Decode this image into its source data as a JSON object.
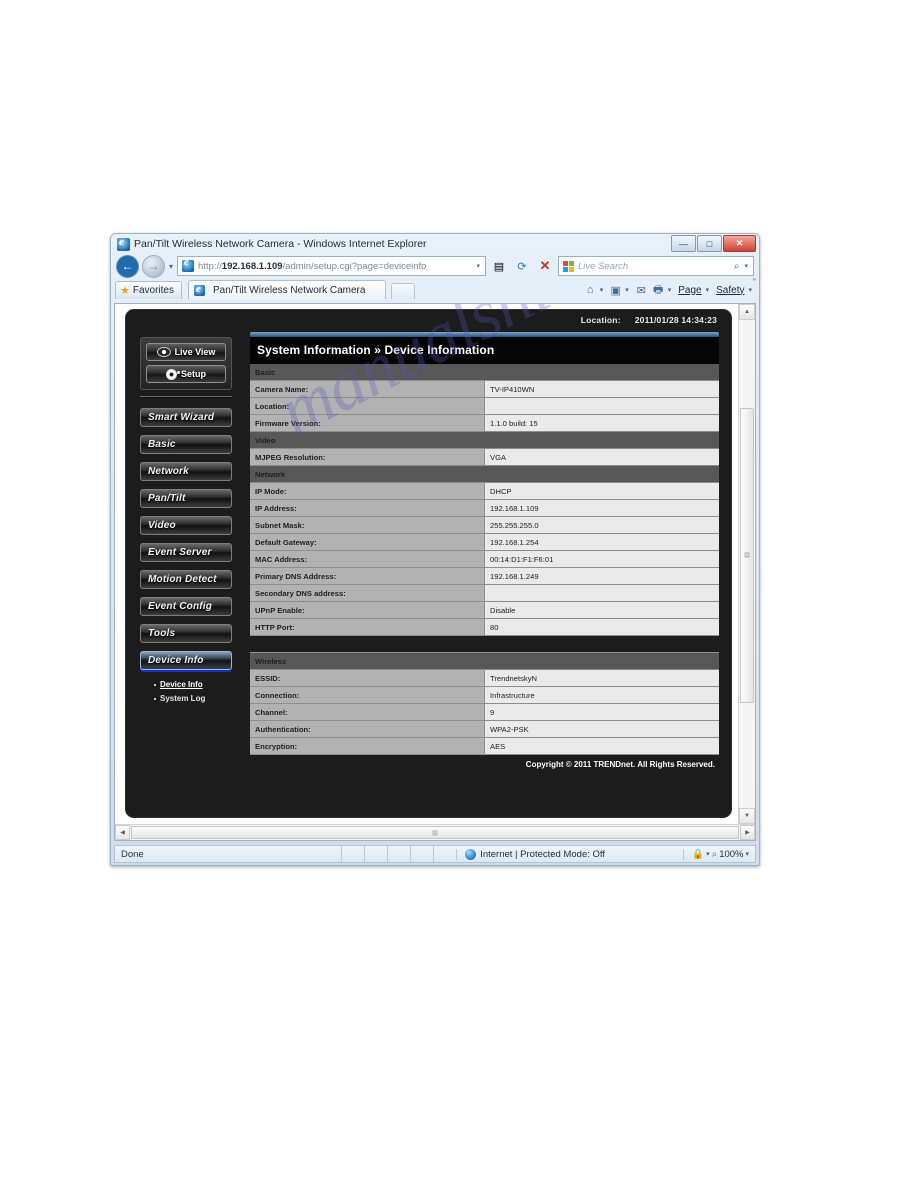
{
  "window": {
    "title": "Pan/Tilt Wireless Network Camera - Windows Internet Explorer",
    "minimize_label": "—",
    "maximize_label": "□",
    "close_label": "✕"
  },
  "address_bar": {
    "url_protocol": "http://",
    "url_host": "192.168.1.109",
    "url_path": "/admin/setup.cgi?page=deviceinfo",
    "dropdown_label": "▾",
    "refresh_label": "⟳",
    "stop_label": "✕"
  },
  "search": {
    "placeholder": "Live Search",
    "magnifier": "⌕",
    "dropdown": "▾"
  },
  "tabs": {
    "favorites_label": "Favorites",
    "active_tab_label": "Pan/Tilt Wireless Network Camera",
    "new_tab_label": ""
  },
  "toolbar": {
    "page_label": "Page",
    "safety_label": "Safety",
    "caret": "▾",
    "help_sup": "»"
  },
  "status_bar": {
    "status_text": "Done",
    "zone_text": "Internet | Protected Mode: Off",
    "zoom_level": "100%",
    "caret": "▾"
  },
  "camera_ui": {
    "location_label": "Location:",
    "location_value": "2011/01/28 14:34:23",
    "panel_title": "System Information » Device Information",
    "footer": "Copyright © 2011 TRENDnet. All Rights Reserved.",
    "watermark": "manualshive.com",
    "mode_buttons": [
      {
        "label": "Live View",
        "icon": "eye-icon"
      },
      {
        "label": "Setup",
        "icon": "gear-icon"
      }
    ],
    "menu_items": [
      {
        "label": "Smart Wizard",
        "active": false
      },
      {
        "label": "Basic",
        "active": false
      },
      {
        "label": "Network",
        "active": false
      },
      {
        "label": "Pan/Tilt",
        "active": false
      },
      {
        "label": "Video",
        "active": false
      },
      {
        "label": "Event Server",
        "active": false
      },
      {
        "label": "Motion Detect",
        "active": false
      },
      {
        "label": "Event Config",
        "active": false
      },
      {
        "label": "Tools",
        "active": false
      },
      {
        "label": "Device Info",
        "active": true
      }
    ],
    "submenu_items": [
      {
        "label": "Device Info",
        "selected": true
      },
      {
        "label": "System Log",
        "selected": false
      }
    ],
    "sections": [
      {
        "title": "Basic",
        "rows": [
          {
            "label": "Camera Name:",
            "value": "TV-IP410WN"
          },
          {
            "label": "Location:",
            "value": ""
          },
          {
            "label": "Firmware Version:",
            "value": "1.1.0 build: 15"
          }
        ]
      },
      {
        "title": "Video",
        "rows": [
          {
            "label": "MJPEG Resolution:",
            "value": "VGA"
          }
        ]
      },
      {
        "title": "Network",
        "rows": [
          {
            "label": "IP Mode:",
            "value": "DHCP"
          },
          {
            "label": "IP Address:",
            "value": "192.168.1.109"
          },
          {
            "label": "Subnet Mask:",
            "value": "255.255.255.0"
          },
          {
            "label": "Default Gateway:",
            "value": "192.168.1.254"
          },
          {
            "label": "MAC Address:",
            "value": "00:14:D1:F1:F6:01"
          },
          {
            "label": "Primary DNS Address:",
            "value": "192.168.1.249"
          },
          {
            "label": "Secondary DNS address:",
            "value": ""
          },
          {
            "label": "UPnP Enable:",
            "value": "Disable"
          },
          {
            "label": "HTTP Port:",
            "value": "80"
          }
        ]
      },
      {
        "title": "Wireless",
        "rows": [
          {
            "label": "ESSID:",
            "value": "TrendnetskyN"
          },
          {
            "label": "Connection:",
            "value": "Infrastructure"
          },
          {
            "label": "Channel:",
            "value": "9"
          },
          {
            "label": "Authentication:",
            "value": "WPA2-PSK"
          },
          {
            "label": "Encryption:",
            "value": "AES"
          }
        ]
      }
    ]
  }
}
